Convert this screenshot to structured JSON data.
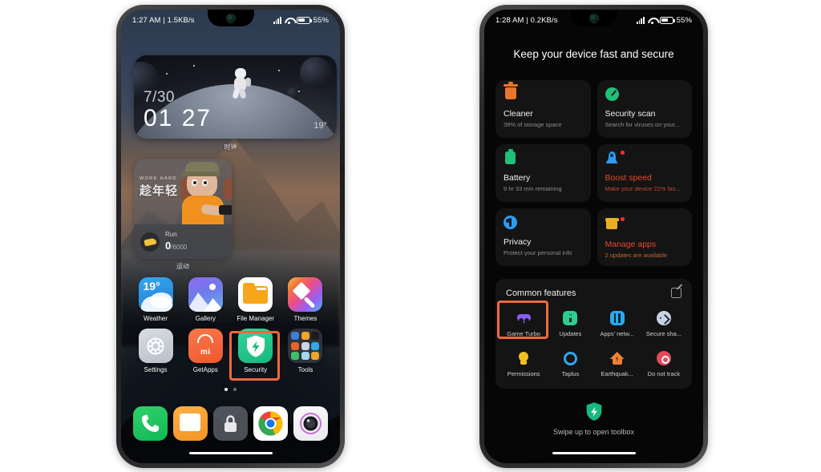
{
  "left_phone": {
    "status_bar": {
      "time_and_speed": "1:27 AM | 1.5KB/s",
      "battery_percent": "55%",
      "icons": [
        "signal-icon",
        "wifi-icon",
        "battery-icon"
      ]
    },
    "clock_widget": {
      "date": "7/30",
      "time": "01 27",
      "temperature": "19°",
      "label": "时钟"
    },
    "fitness_widget": {
      "slogan_en": "WORK HARD",
      "slogan_cn": "趁年轻",
      "metric_name": "Run",
      "metric_value": "0",
      "metric_goal": "/6000",
      "label": "运动"
    },
    "app_rows": [
      [
        {
          "name": "Weather",
          "icon": "weather-icon",
          "badge": "19°"
        },
        {
          "name": "Gallery",
          "icon": "gallery-icon"
        },
        {
          "name": "File Manager",
          "icon": "file-manager-icon"
        },
        {
          "name": "Themes",
          "icon": "themes-icon"
        }
      ],
      [
        {
          "name": "Settings",
          "icon": "settings-icon"
        },
        {
          "name": "GetApps",
          "icon": "getapps-icon",
          "badge": "mi"
        },
        {
          "name": "Security",
          "icon": "security-icon",
          "highlighted": true
        },
        {
          "name": "Tools",
          "icon": "tools-folder-icon"
        }
      ]
    ],
    "page_dots": {
      "total": 2,
      "active": 1
    },
    "dock": [
      {
        "name": "Phone",
        "icon": "phone-icon"
      },
      {
        "name": "Messages",
        "icon": "messages-icon"
      },
      {
        "name": "Lock",
        "icon": "lock-icon"
      },
      {
        "name": "Chrome",
        "icon": "chrome-icon"
      },
      {
        "name": "Camera",
        "icon": "camera-icon"
      }
    ]
  },
  "right_phone": {
    "status_bar": {
      "time_and_speed": "1:28 AM | 0.2KB/s",
      "battery_percent": "55%",
      "icons": [
        "signal-icon",
        "wifi-icon",
        "battery-icon"
      ]
    },
    "header_title": "Keep your device fast and secure",
    "cards": [
      {
        "title": "Cleaner",
        "subtitle": "39% of storage space",
        "icon": "trash-icon",
        "style": "normal"
      },
      {
        "title": "Security scan",
        "subtitle": "Search for viruses on your...",
        "icon": "scan-icon",
        "style": "normal"
      },
      {
        "title": "Battery",
        "subtitle": "9 hr 33 min  remaining",
        "icon": "battery-icon",
        "style": "normal"
      },
      {
        "title": "Boost speed",
        "subtitle": "Make your device 22% fas...",
        "icon": "rocket-icon",
        "style": "warn",
        "dot": true
      },
      {
        "title": "Privacy",
        "subtitle": "Protect your personal info",
        "icon": "privacy-icon",
        "style": "normal"
      },
      {
        "title": "Manage apps",
        "subtitle": "2 updates are available",
        "icon": "manage-apps-icon",
        "style": "warn2",
        "dot": true
      }
    ],
    "common_features": {
      "title": "Common features",
      "edit_icon": "edit-icon",
      "items": [
        {
          "label": "Game Turbo",
          "icon": "gamepad-icon",
          "highlighted": true
        },
        {
          "label": "Updates",
          "icon": "updates-icon"
        },
        {
          "label": "Apps' netw...",
          "icon": "apps-network-icon"
        },
        {
          "label": "Secure sha...",
          "icon": "secure-share-icon"
        },
        {
          "label": "Permissions",
          "icon": "permissions-icon"
        },
        {
          "label": "Taplus",
          "icon": "taplus-icon"
        },
        {
          "label": "Earthquak...",
          "icon": "earthquake-icon"
        },
        {
          "label": "Do not track",
          "icon": "do-not-track-icon"
        }
      ]
    },
    "toolbox_hint": {
      "icon": "shield-icon",
      "text": "Swipe up to open toolbox"
    }
  },
  "colors": {
    "highlight": "#f2683c",
    "accent_green": "#17b97e",
    "warn_red": "#e8492b",
    "warn_orange": "#e8b020",
    "card_bg": "#141414",
    "screen_bg": "#060606"
  }
}
